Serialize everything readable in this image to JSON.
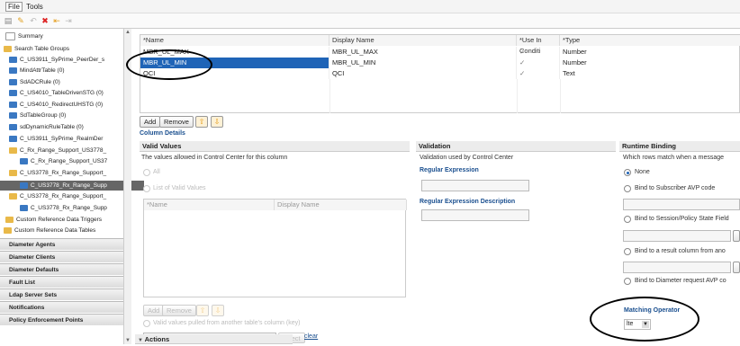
{
  "menu": {
    "file": "File",
    "tools": "Tools"
  },
  "tree": {
    "items": [
      {
        "label": "Summary",
        "icon": "file-icon"
      },
      {
        "label": "Search Table Groups",
        "icon": "folder-icon"
      },
      {
        "label": "C_US3911_SyPrime_PeerDer_s",
        "icon": "table-icon"
      },
      {
        "label": "MindAttrTable (0)",
        "icon": "table-icon"
      },
      {
        "label": "SdADCRule (0)",
        "icon": "table-icon"
      },
      {
        "label": "C_US4010_TableDrivenSTG (0)",
        "icon": "table-icon"
      },
      {
        "label": "C_US4010_RedirectUHSTG (0)",
        "icon": "table-icon"
      },
      {
        "label": "SdTableGroup (0)",
        "icon": "table-icon"
      },
      {
        "label": "sdDynamicRuleTable (0)",
        "icon": "table-icon"
      },
      {
        "label": "C_US3911_SyPrime_RealmDer",
        "icon": "table-icon"
      },
      {
        "label": "C_Rx_Range_Support_US3778_",
        "icon": "folder-icon"
      },
      {
        "label": "C_Rx_Range_Support_US37",
        "icon": "table-icon"
      },
      {
        "label": "C_US3778_Rx_Range_Support_",
        "icon": "folder-icon"
      },
      {
        "label": "C_US3778_Rx_Range_Supp",
        "icon": "table-icon"
      },
      {
        "label": "C_US3778_Rx_Range_Support_",
        "icon": "folder-icon"
      },
      {
        "label": "C_US3778_Rx_Range_Supp",
        "icon": "table-icon"
      },
      {
        "label": "Custom Reference Data Triggers",
        "icon": "folder-icon"
      },
      {
        "label": "Custom Reference Data Tables",
        "icon": "folder-icon"
      }
    ],
    "nav": [
      "Diameter Agents",
      "Diameter Clients",
      "Diameter Defaults",
      "Fault List",
      "Ldap Server Sets",
      "Notifications",
      "Policy Enforcement Points"
    ]
  },
  "columns_grid": {
    "headers": [
      "*Name",
      "Display Name",
      "*Use In Conditi",
      "*Type"
    ],
    "rows": [
      {
        "name": "MBR_UL_MAX",
        "display": "MBR_UL_MAX",
        "use": "✓",
        "type": "Number"
      },
      {
        "name": "MBR_UL_MIN",
        "display": "MBR_UL_MIN",
        "use": "✓",
        "type": "Number"
      },
      {
        "name": "QCI",
        "display": "QCI",
        "use": "✓",
        "type": "Text"
      }
    ]
  },
  "grid_buttons": {
    "add": "Add",
    "remove": "Remove"
  },
  "column_details": "Column Details",
  "valid_values": {
    "title": "Valid Values",
    "desc": "The values allowed in Control Center for this column",
    "all": "All",
    "list": "List of Valid Values",
    "headers": [
      "*Name",
      "Display Name"
    ],
    "add": "Add",
    "remove": "Remove",
    "pulled": "Valid values pulled from another table's column (key)",
    "select": "select",
    "clear": "clear"
  },
  "validation": {
    "title": "Validation",
    "desc": "Validation used by Control Center",
    "regex": "Regular Expression",
    "regex_desc": "Regular Expression Description"
  },
  "runtime": {
    "title": "Runtime Binding",
    "desc": "Which rows match when a message",
    "none": "None",
    "subscriber": "Bind to Subscriber AVP code",
    "session": "Bind to Session/Policy State Field",
    "result": "Bind to a result column from ano",
    "diameter": "Bind to Diameter request AVP co",
    "matching": "Matching Operator",
    "operator": "lte"
  },
  "actions": "Actions"
}
